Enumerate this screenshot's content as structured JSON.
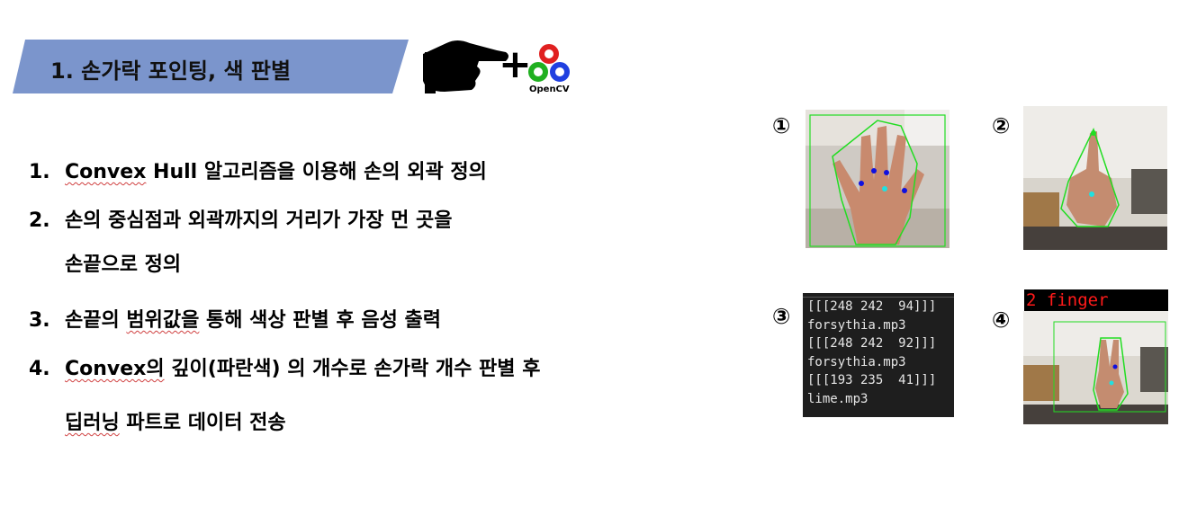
{
  "header": {
    "title": "1. 손가락 포인팅, 색 판별"
  },
  "logo": {
    "plus": "+",
    "opencv_text": "OpenCV",
    "hand_icon": "pointing-hand-icon"
  },
  "steps": [
    {
      "num": "1.",
      "pre": "",
      "squiggle": "Convex",
      "post": " Hull 알고리즘을 이용해 손의 외곽 정의"
    },
    {
      "num": "2.",
      "pre": "",
      "squiggle": "",
      "post": "손의 중심점과 외곽까지의 거리가 가장 먼 곳을"
    },
    {
      "num": "",
      "pre": "",
      "squiggle": "",
      "post": "손끝으로 정의"
    },
    {
      "num": "3.",
      "pre": "손끝의 ",
      "squiggle": "범위값을",
      "post": " 통해 색상 판별 후 음성 출력"
    },
    {
      "num": "4.",
      "pre": "",
      "squiggle": "Convex의",
      "post": " 깊이(파란색) 의 개수로 손가락 개수 판별 후"
    },
    {
      "num": "",
      "pre": "",
      "squiggle": "딥러닝",
      "post": " 파트로 데이터 전송"
    }
  ],
  "figures": {
    "labels": [
      "①",
      "②",
      "③",
      "④"
    ],
    "terminal": [
      "[[[248 242  94]]]",
      "forsythia.mp3",
      "[[[248 242  92]]]",
      "forsythia.mp3",
      "[[[193 235  41]]]",
      "lime.mp3"
    ],
    "finger_label": "2 finger"
  },
  "colors": {
    "banner": "#7b95cc",
    "hull": "#22dd22",
    "defect": "#1010e0",
    "center": "#20e0e0"
  }
}
